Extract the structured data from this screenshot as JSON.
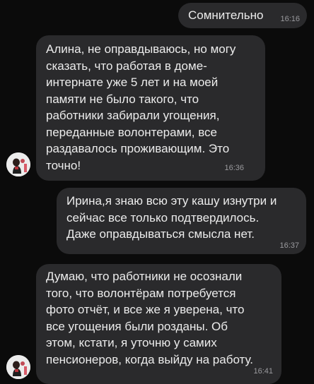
{
  "messages": [
    {
      "direction": "outgoing",
      "lines": [
        "Сомнительно"
      ],
      "time": "16:16"
    },
    {
      "direction": "incoming",
      "lines": [
        "Алина, не оправдываюсь, но могу",
        "сказать, что работая в доме-",
        "интернате уже 5 лет и на моей",
        "памяти не было такого, что",
        "работники забирали угощения,",
        "переданные волонтерами, все",
        "раздавалось проживающим. Это",
        "точно!"
      ],
      "time": "16:36"
    },
    {
      "direction": "outgoing",
      "lines": [
        "Ирина,я знаю всю эту кашу изнутри и",
        "сейчас все только подтвердилось.",
        "Даже оправдываться смысла нет."
      ],
      "time": "16:37"
    },
    {
      "direction": "incoming",
      "lines": [
        "Думаю, что работники не осознали",
        "того, что волонтёрам потребуется",
        "фото отчёт, и все же я уверена, что",
        "все угощения были розданы. Об",
        "этом, кстати, я уточню у самих",
        "пенсионеров, когда выйду на работу."
      ],
      "time": "16:41"
    }
  ],
  "colors": {
    "background": "#0b0b0b",
    "bubble": "#2a2a2c",
    "text": "#ececec",
    "time": "#9a9a9e"
  },
  "icons": {
    "avatar": "avatar-icon"
  }
}
